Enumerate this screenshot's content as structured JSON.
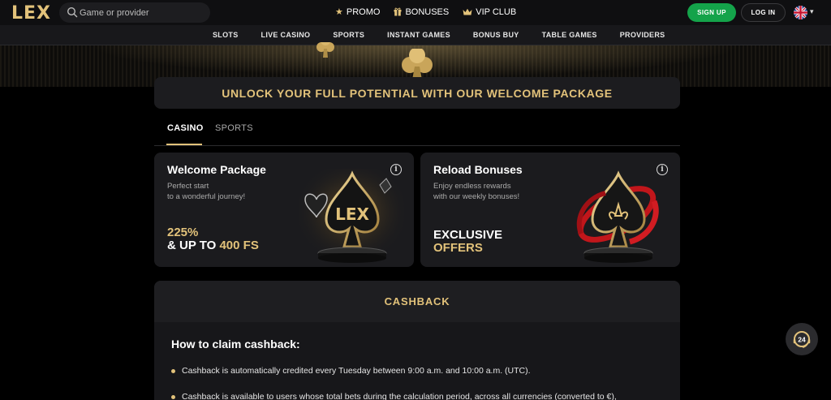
{
  "header": {
    "logo_text": "LEX",
    "search_placeholder": "Game or provider",
    "nav": [
      {
        "label": "PROMO",
        "icon": "star-icon"
      },
      {
        "label": "BONUSES",
        "icon": "gift-icon"
      },
      {
        "label": "VIP CLUB",
        "icon": "crown-icon"
      }
    ],
    "signup_label": "SIGN UP",
    "login_label": "LOG IN",
    "language_icon": "uk-flag-icon"
  },
  "categories": [
    "SLOTS",
    "LIVE CASINO",
    "SPORTS",
    "INSTANT GAMES",
    "BONUS BUY",
    "TABLE GAMES",
    "PROVIDERS"
  ],
  "banner": {
    "text": "UNLOCK YOUR FULL POTENTIAL WITH OUR WELCOME PACKAGE"
  },
  "tabs": [
    {
      "label": "CASINO",
      "active": true
    },
    {
      "label": "SPORTS",
      "active": false
    }
  ],
  "cards": [
    {
      "title": "Welcome Package",
      "desc_line1": "Perfect start",
      "desc_line2": "to a wonderful journey!",
      "highlight": "225%",
      "offer_prefix": "& UP TO ",
      "offer_value": "400 FS",
      "art_text": "LEX"
    },
    {
      "title": "Reload Bonuses",
      "desc_line1": "Enjoy endless rewards",
      "desc_line2": "with our weekly bonuses!",
      "offer_line1": "EXCLUSIVE",
      "offer_line2": "OFFERS"
    }
  ],
  "cashback": {
    "title": "CASHBACK",
    "howto": "How to claim cashback:",
    "items": [
      "Cashback is automatically credited every Tuesday between 9:00 a.m. and 10:00 a.m. (UTC).",
      "Cashback is available to users whose total bets during the calculation period, across all currencies (converted to €),"
    ]
  },
  "support": {
    "label": "24"
  },
  "colors": {
    "gold": "#e2c27a",
    "signup_green": "#14a34a",
    "background": "#000000",
    "card": "#1b1b1e"
  }
}
